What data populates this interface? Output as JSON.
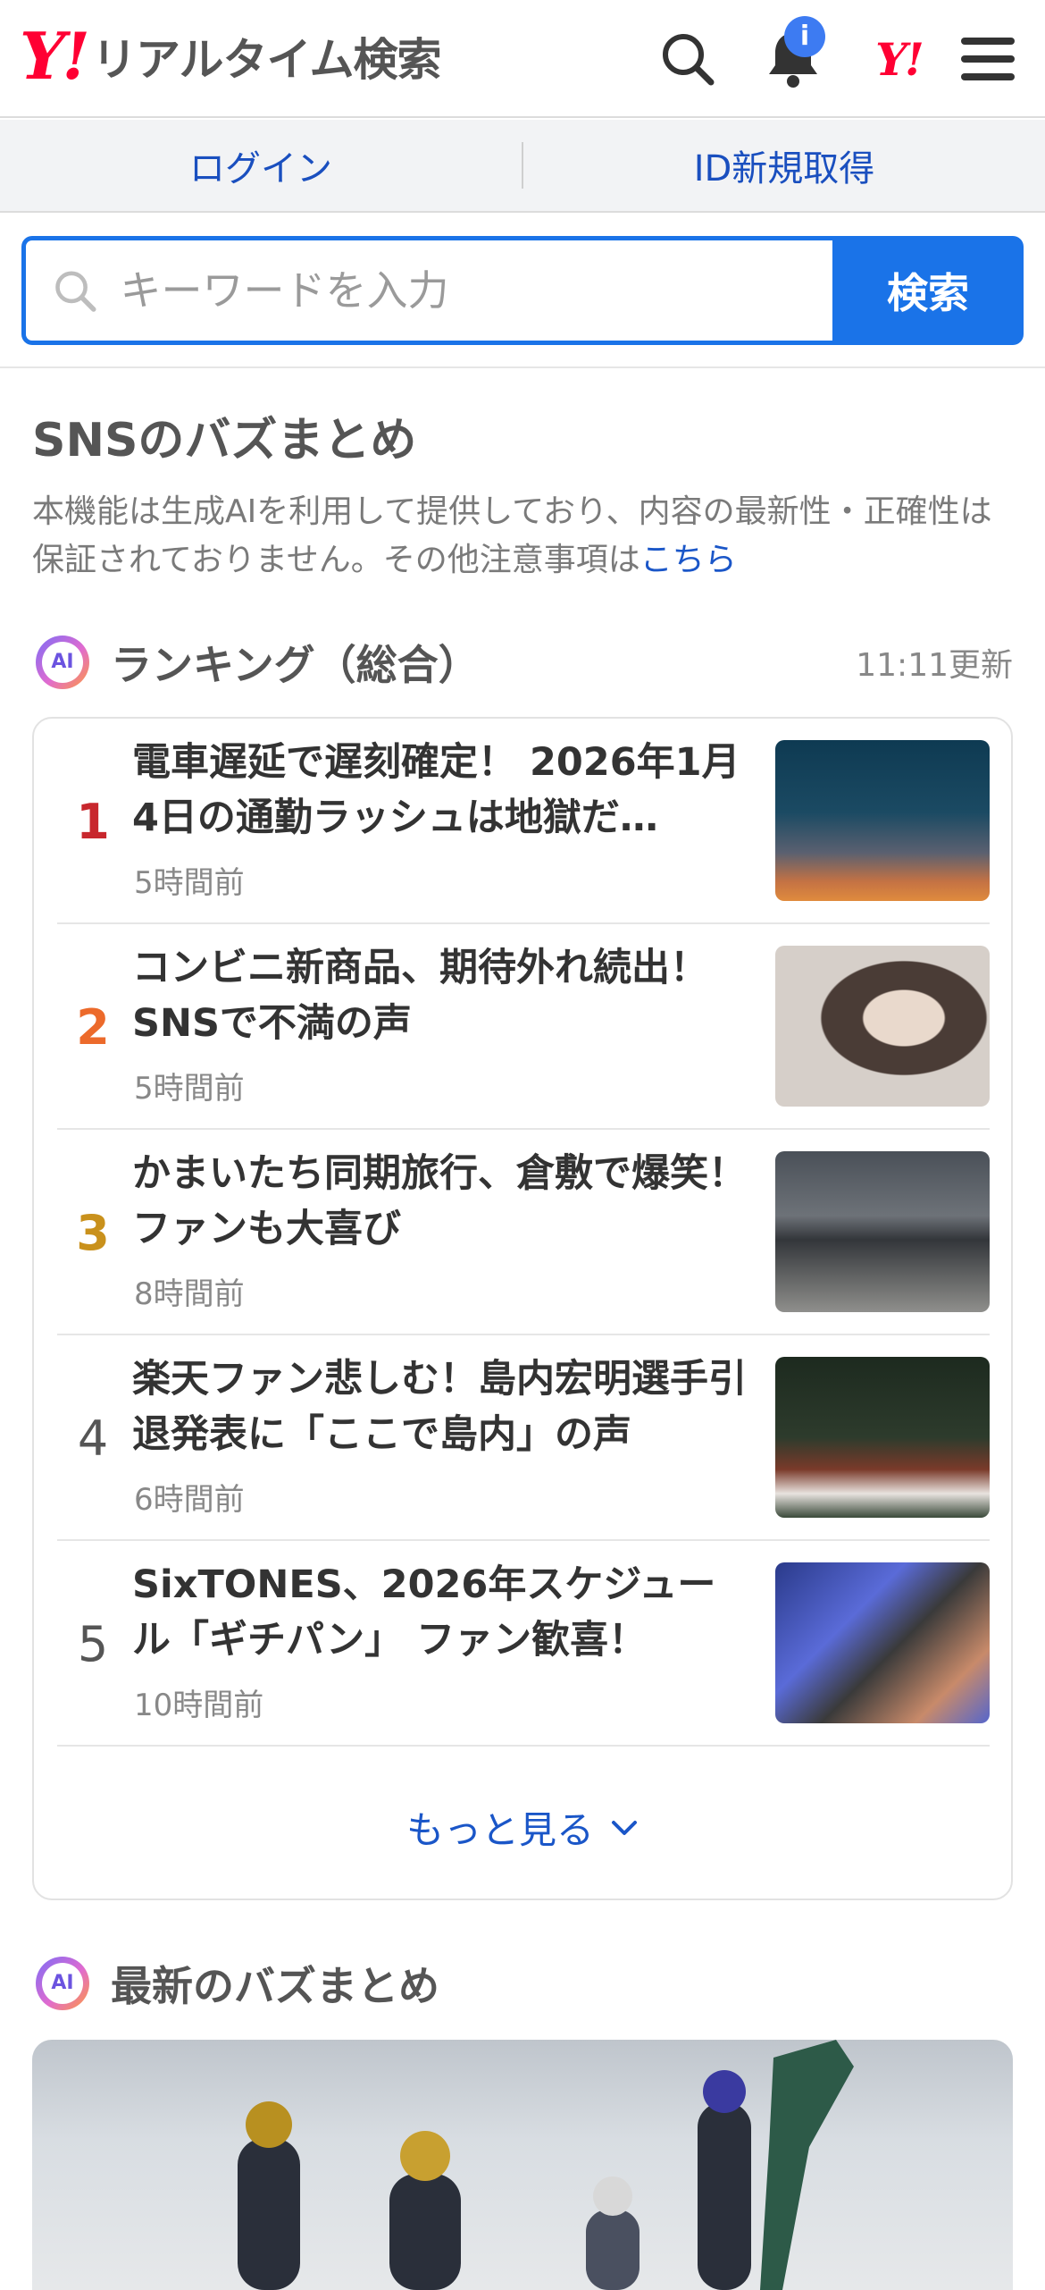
{
  "header": {
    "logo_mark": "Y!",
    "logo_text": "リアルタイム検索",
    "notification_badge": "i",
    "yahoo_mark": "Y!"
  },
  "login_bar": {
    "login": "ログイン",
    "register": "ID新規取得"
  },
  "search": {
    "placeholder": "キーワードを入力",
    "button": "検索"
  },
  "section": {
    "title": "SNSのバズまとめ",
    "notice": "本機能は生成AIを利用して提供しており、内容の最新性・正確性は保証されておりません。その他注意事項は",
    "notice_link": "こちら"
  },
  "ranking": {
    "ai_label": "AI",
    "title": "ランキング（総合）",
    "updated": "11:11更新",
    "items": [
      {
        "rank": "1",
        "title": "電車遅延で遅刻確定！ 2026年1月4日の通勤ラッシュは地獄だ…",
        "time": "5時間前"
      },
      {
        "rank": "2",
        "title": "コンビニ新商品、期待外れ続出！SNSで不満の声",
        "time": "5時間前"
      },
      {
        "rank": "3",
        "title": "かまいたち同期旅行、倉敷で爆笑！ファンも大喜び",
        "time": "8時間前"
      },
      {
        "rank": "4",
        "title": "楽天ファン悲しむ！島内宏明選手引退発表に「ここで島内」の声",
        "time": "6時間前"
      },
      {
        "rank": "5",
        "title": "SixTONES、2026年スケジュール「ギチパン」 ファン歓喜！",
        "time": "10時間前"
      }
    ],
    "more": "もっと見る"
  },
  "latest": {
    "ai_label": "AI",
    "title": "最新のバズまとめ"
  },
  "colors": {
    "brand_red": "#ff0033",
    "link_blue": "#1a56c8",
    "search_blue": "#1a73e8"
  },
  "icons": [
    "search-icon",
    "bell-icon",
    "menu-icon",
    "chevron-down-icon",
    "ai-icon"
  ]
}
